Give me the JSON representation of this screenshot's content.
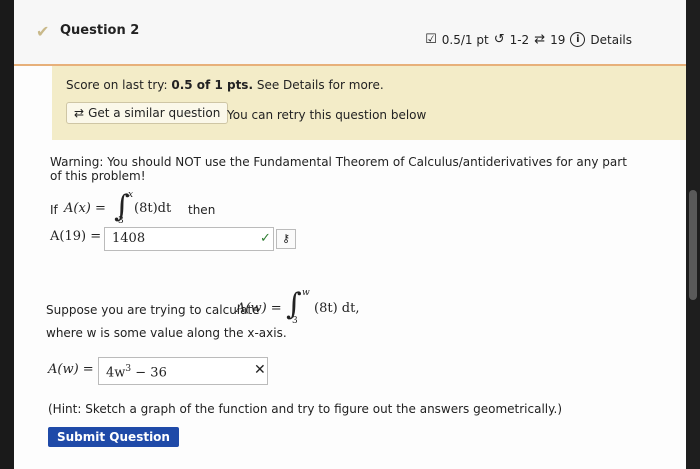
{
  "header": {
    "question_title": "Question 2",
    "score": "0.5/1 pt",
    "retries": "1-2",
    "attempts": "19",
    "details_label": "Details"
  },
  "score_panel": {
    "score_prefix": "Score on last try: ",
    "score_value": "0.5 of 1 pts.",
    "score_suffix": " See Details for more.",
    "similar_button": "Get a similar question",
    "retry_text": "You can retry this question below"
  },
  "warning": "Warning: You should NOT use the Fundamental Theorem of Calculus/antiderivatives for any part of this problem!",
  "part1": {
    "if_label": "If",
    "lhs": "A(x) =",
    "upper_limit": "x",
    "lower_limit": "3",
    "integrand": "(8t)dt",
    "then_label": "then",
    "answer_label": "A(19) =",
    "answer_value": "1408"
  },
  "part2": {
    "intro": "Suppose you are trying to calculate",
    "lhs": "A(w) =",
    "upper_limit": "w",
    "lower_limit": "3",
    "integrand": "(8t) dt,",
    "where_text": "where w is some value along the x-axis.",
    "answer_label": "A(w) =",
    "answer_base": "4w",
    "answer_exp": "3",
    "answer_rest": " − 36"
  },
  "hint": "(Hint: Sketch a graph of the function and try to figure out the answers geometrically.)",
  "submit_label": "Submit Question",
  "colors": {
    "accent_orange": "#e7b07a",
    "score_bg": "#f3ecc8",
    "submit_bg": "#1f4aa8",
    "correct_green": "#2e7d32"
  },
  "icons": {
    "score": "checkbox-icon",
    "retries": "retry-icon",
    "attempts": "arrows-icon",
    "details": "info-icon"
  }
}
